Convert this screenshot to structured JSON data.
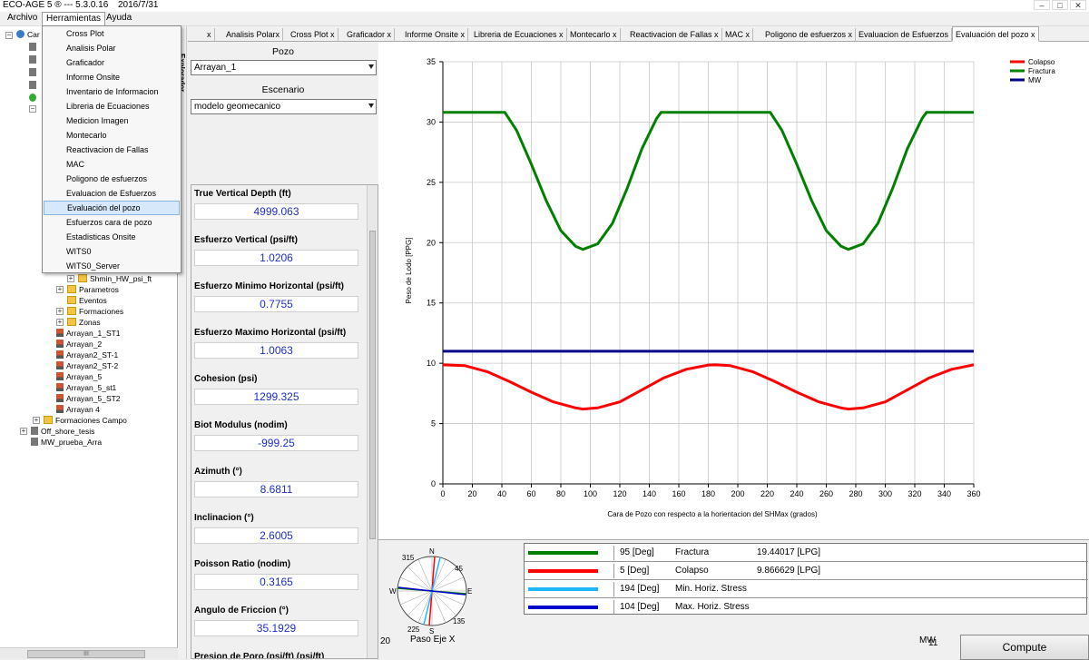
{
  "app": {
    "title": "ECO-AGE 5 ® --- 5.3.0.16",
    "date": "2016/7/31"
  },
  "window_buttons": [
    "–",
    "□",
    "✕"
  ],
  "menu": {
    "archivo": "Archivo",
    "herramientas": "Herramientas",
    "ayuda": "Ayuda"
  },
  "herramientas_items": [
    "Cross Plot",
    "Analisis Polar",
    "Graficador",
    "Informe Onsite",
    "Inventario de Informacion",
    "Libreria de Ecuaciones",
    "Medicion Imagen",
    "Montecarlo",
    "Reactivacion de Fallas",
    "MAC",
    "Poligono de esfuerzos",
    "Evaluacion de Esfuerzos",
    "Evaluación del pozo",
    "Esfuerzos cara de pozo",
    "Estadisticas Onsite",
    "WITS0",
    "WITS0_Server"
  ],
  "highlighted_menu_item": "Evaluación del pozo",
  "tree": {
    "root_label": "Car",
    "items": [
      "Shmin_HW_psi_ft",
      "Parametros",
      "Eventos",
      "Formaciones",
      "Zonas",
      "Arrayan_1_ST1",
      "Arrayan_2",
      "Arrayan2_ST-1",
      "Arrayan2_ST-2",
      "Arrayan_5",
      "Arrayan_5_st1",
      "Arrayan_5_ST2",
      "Arrayan 4",
      "Formaciones Campo",
      "Off_shore_tesis",
      "MW_prueba_Arra"
    ]
  },
  "sidebar_label": "Explorador",
  "tabs": [
    "x",
    "Analisis Polarx",
    "Cross Plot x",
    "Graficador x",
    "Informe Onsite x",
    "Libreria de Ecuaciones x",
    "Montecarlo x",
    "Reactivacion de Fallas x",
    "MAC x",
    "Poligono de esfuerzos x",
    "Evaluacion de Esfuerzos",
    "Evaluación del pozo x"
  ],
  "panel": {
    "pozo_label": "Pozo",
    "pozo_value": "Arrayan_1",
    "escenario_label": "Escenario",
    "escenario_value": "modelo geomecanico",
    "properties": [
      {
        "label": "True Vertical Depth (ft)",
        "value": "4999.063"
      },
      {
        "label": "Esfuerzo Vertical (psi/ft)",
        "value": "1.0206"
      },
      {
        "label": "Esfuerzo Minimo Horizontal (psi/ft)",
        "value": "0.7755"
      },
      {
        "label": "Esfuerzo Maximo Horizontal (psi/ft)",
        "value": "1.0063"
      },
      {
        "label": "Cohesion (psi)",
        "value": "1299.325"
      },
      {
        "label": "Biot Modulus (nodim)",
        "value": "-999.25"
      },
      {
        "label": "Azimuth (°)",
        "value": "8.6811"
      },
      {
        "label": "Inclinacion (°)",
        "value": "2.6005"
      },
      {
        "label": "Poisson Ratio (nodim)",
        "value": "0.3165"
      },
      {
        "label": "Angulo de Friccion (°)",
        "value": "35.1929"
      },
      {
        "label": "Presion de Poro (psi/ft) (psi/ft)",
        "value": ""
      }
    ]
  },
  "chart_data": {
    "type": "line",
    "xlabel": "Cara de Pozo con respecto a la horientacion del SHMax (grados)",
    "ylabel": "Peso de Lodo [PPG]",
    "xlim": [
      0,
      360
    ],
    "ylim": [
      0,
      35
    ],
    "xticks": [
      0,
      20,
      40,
      60,
      80,
      100,
      120,
      140,
      160,
      180,
      200,
      220,
      240,
      260,
      280,
      300,
      320,
      340,
      360
    ],
    "yticks": [
      0,
      5,
      10,
      15,
      20,
      25,
      30,
      35
    ],
    "grid": true,
    "legend_position": "top-right",
    "series": [
      {
        "name": "Colapso",
        "color": "#ff0000",
        "x": [
          0,
          15,
          30,
          45,
          60,
          75,
          90,
          95,
          105,
          120,
          135,
          150,
          165,
          180,
          185,
          195,
          210,
          225,
          240,
          255,
          270,
          275,
          285,
          300,
          315,
          330,
          345,
          360
        ],
        "y": [
          9.87,
          9.8,
          9.3,
          8.5,
          7.6,
          6.8,
          6.3,
          6.2,
          6.3,
          6.8,
          7.8,
          8.8,
          9.5,
          9.85,
          9.87,
          9.8,
          9.3,
          8.5,
          7.6,
          6.8,
          6.3,
          6.2,
          6.3,
          6.8,
          7.8,
          8.8,
          9.5,
          9.87
        ]
      },
      {
        "name": "Fractura",
        "color": "#008000",
        "x": [
          0,
          42,
          50,
          60,
          70,
          80,
          90,
          95,
          105,
          115,
          125,
          135,
          145,
          148,
          222,
          230,
          240,
          250,
          260,
          270,
          275,
          285,
          295,
          305,
          315,
          325,
          328,
          360
        ],
        "y": [
          30.8,
          30.8,
          29.3,
          26.5,
          23.5,
          21.0,
          19.7,
          19.44,
          19.9,
          21.6,
          24.5,
          27.8,
          30.3,
          30.8,
          30.8,
          29.3,
          26.5,
          23.5,
          21.0,
          19.7,
          19.44,
          19.9,
          21.6,
          24.5,
          27.8,
          30.3,
          30.8,
          30.8
        ]
      },
      {
        "name": "MW",
        "color": "#00008b",
        "x": [
          0,
          360
        ],
        "y": [
          11,
          11
        ]
      }
    ]
  },
  "legend_rows": [
    {
      "color": "#008000",
      "deg": "95 [Deg]",
      "name": "Fractura",
      "value": "19.44017 [LPG]"
    },
    {
      "color": "#ff0000",
      "deg": "5 [Deg]",
      "name": "Colapso",
      "value": "9.866629 [LPG]"
    },
    {
      "color": "#1fb6ff",
      "deg": "194 [Deg]",
      "name": "Min. Horiz. Stress",
      "value": ""
    },
    {
      "color": "#0000cc",
      "deg": "104 [Deg]",
      "name": "Max. Horiz. Stress",
      "value": ""
    }
  ],
  "compass": {
    "n": "N",
    "s": "S",
    "e": "E",
    "w": "W",
    "a315": "315",
    "a45": "45",
    "a135": "135",
    "a225": "225"
  },
  "bottom": {
    "paso_label": "Paso Eje X",
    "paso_value": "20",
    "mw_label": "MW",
    "mw_value": "11",
    "compute_label": "Compute"
  }
}
